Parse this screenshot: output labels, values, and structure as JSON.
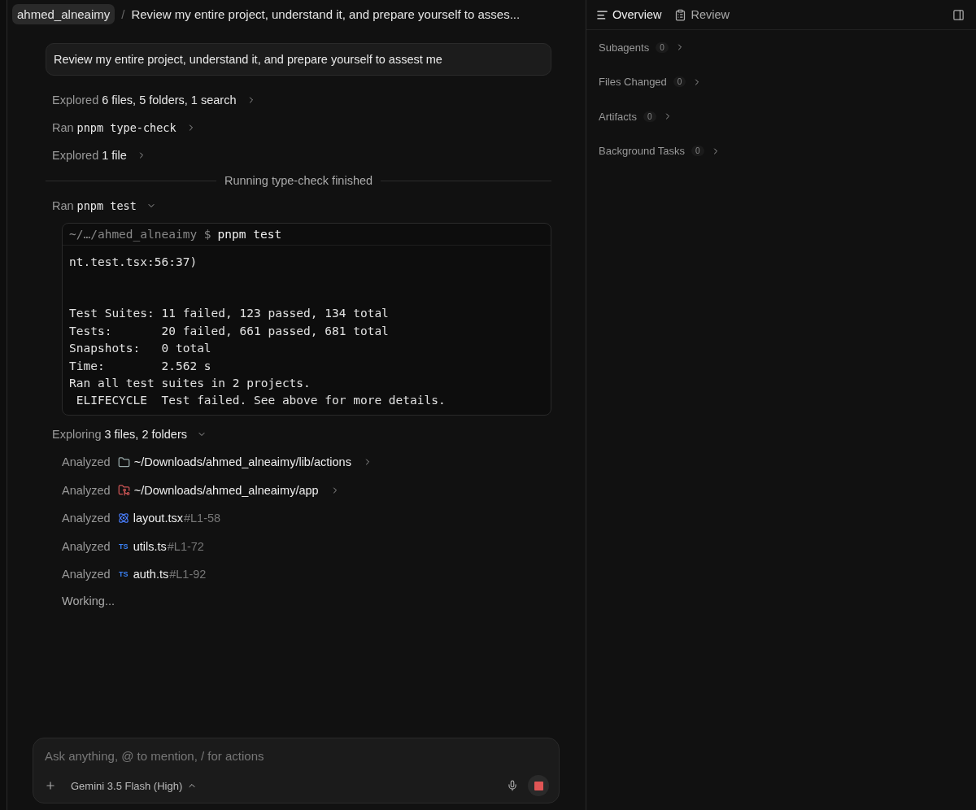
{
  "breadcrumb": {
    "project": "ahmed_alneaimy",
    "separator": "/",
    "title": "Review my entire project, understand it, and prepare yourself to asses..."
  },
  "user_message": "Review my entire project, understand it, and prepare yourself to assest me",
  "steps": [
    {
      "kind": "explore",
      "verb": "Explored",
      "detail": "6 files, 5 folders, 1 search",
      "expanded": false
    },
    {
      "kind": "command",
      "verb": "Ran",
      "detail": "pnpm type-check",
      "expanded": false
    },
    {
      "kind": "explore",
      "verb": "Explored",
      "detail": "1 file",
      "expanded": false
    },
    {
      "kind": "divider",
      "text": "Running type-check finished"
    },
    {
      "kind": "command",
      "verb": "Ran",
      "detail": "pnpm test",
      "expanded": true,
      "terminal": {
        "prompt": "~/…/ahmed_alneaimy $",
        "command": "pnpm test",
        "blocks": [
          [
            "nt.test.tsx:56:37)"
          ],
          [
            "Test Suites: 11 failed, 123 passed, 134 total",
            "Tests:       20 failed, 661 passed, 681 total",
            "Snapshots:   0 total",
            "Time:        2.562 s",
            "Ran all test suites in 2 projects.",
            " ELIFECYCLE  Test failed. See above for more details."
          ]
        ]
      }
    },
    {
      "kind": "explore",
      "verb": "Exploring",
      "detail": "3 files, 2 folders",
      "expanded": true,
      "children": [
        {
          "verb": "Analyzed",
          "kind": "folder",
          "path": "~/Downloads/ahmed_alneaimy/lib/actions",
          "expandable": true
        },
        {
          "verb": "Analyzed",
          "kind": "repo",
          "path": "~/Downloads/ahmed_alneaimy/app",
          "expandable": true
        },
        {
          "verb": "Analyzed",
          "kind": "react",
          "path": "layout.tsx",
          "range": "#L1-58",
          "expandable": false
        },
        {
          "verb": "Analyzed",
          "kind": "ts",
          "icon_text": "TS",
          "path": "utils.ts",
          "range": "#L1-72",
          "expandable": false
        },
        {
          "verb": "Analyzed",
          "kind": "ts",
          "icon_text": "TS",
          "path": "auth.ts",
          "range": "#L1-92",
          "expandable": false
        }
      ]
    }
  ],
  "status": "Working...",
  "composer": {
    "placeholder": "Ask anything, @ to mention, / for actions",
    "model": "Gemini 3.5 Flash (High)"
  },
  "side_panel": {
    "tabs": [
      {
        "label": "Overview",
        "kind": "overview",
        "selected": true
      },
      {
        "label": "Review",
        "kind": "review",
        "selected": false
      }
    ],
    "sections": [
      {
        "label": "Subagents",
        "count": "0"
      },
      {
        "label": "Files Changed",
        "count": "0"
      },
      {
        "label": "Artifacts",
        "count": "0"
      },
      {
        "label": "Background Tasks",
        "count": "0"
      }
    ]
  }
}
